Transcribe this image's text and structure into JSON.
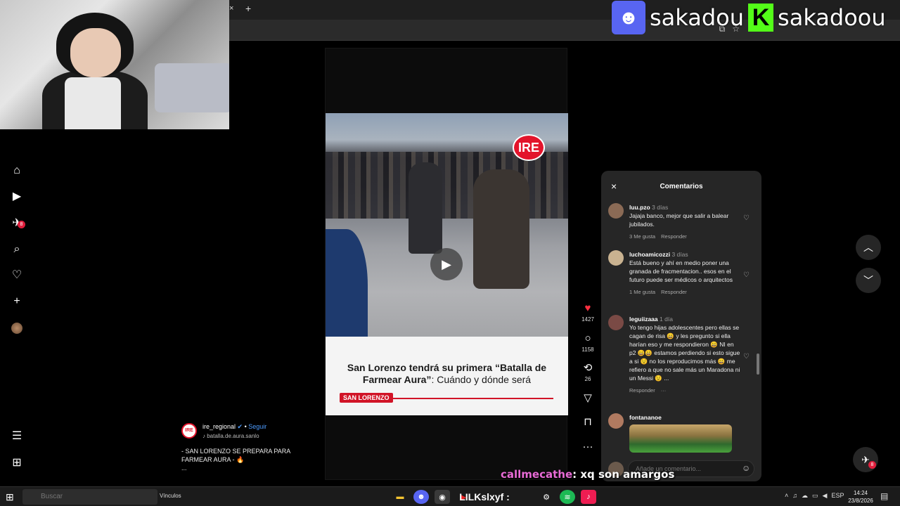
{
  "overlay": {
    "discord_name": "sakadou",
    "kick_name": "sakadoou",
    "discord_icon": "discord-icon",
    "kick_icon": "kick-icon",
    "discord_color": "#5865f2",
    "kick_color": "#53fc18"
  },
  "browser": {
    "tab_close": "×",
    "new_tab": "+"
  },
  "left_nav": {
    "items": [
      {
        "name": "home-icon",
        "glyph": "⌂"
      },
      {
        "name": "reels-icon",
        "glyph": "▶"
      },
      {
        "name": "messages-icon",
        "glyph": "✈",
        "badge": "8"
      },
      {
        "name": "search-icon",
        "glyph": "⌕"
      },
      {
        "name": "notifications-icon",
        "glyph": "♡"
      },
      {
        "name": "create-icon",
        "glyph": "+"
      },
      {
        "name": "profile-icon",
        "glyph": ""
      }
    ],
    "more_icon": "☰",
    "meta_icon": "⊞"
  },
  "reel": {
    "badge": "IRE",
    "play_icon": "▶",
    "headline_bold": "San Lorenzo tendrá su primera “Batalla de Farmear Aura”",
    "headline_rest": ": Cuándo y dónde será",
    "tag": "SAN LORENZO",
    "accent_color": "#d11427"
  },
  "actions": {
    "like_count": "1427",
    "comment_count": "1158",
    "repost_count": "26",
    "like_icon": "heart-icon",
    "comment_icon": "comment-icon",
    "repost_icon": "repost-icon",
    "share_icon": "share-icon",
    "save_icon": "bookmark-icon",
    "more_icon": "more-icon"
  },
  "author": {
    "avatar_text": "IRE",
    "username": "ire_regional",
    "verified": "✔",
    "follow": "Seguir",
    "audio": "batalla.de.aura.sanlo",
    "description_line1": "- SAN LORENZO SE PREPARA PARA FARMEAR AURA - 🔥",
    "description_more": "..."
  },
  "comments": {
    "title": "Comentarios",
    "close_icon": "×",
    "items": [
      {
        "user": "luu.pzo",
        "time": "3 días",
        "text": "Jajaja banco, mejor que salir a balear jubilados.",
        "likes": "3 Me gusta",
        "reply": "Responder"
      },
      {
        "user": "luchoamicozzi",
        "time": "3 días",
        "text": "Está bueno y ahí en medio poner una granada de fracmentacion.. esos en el futuro puede ser médicos o arquitectos",
        "likes": "1 Me gusta",
        "reply": "Responder"
      },
      {
        "user": "leguiizaaa",
        "time": "1 día",
        "text": "Yo tengo hijas adolescentes pero ellas se cagan de risa 😄 y les pregunto si ella harían eso y me respondieron 😄 NI en p2 😄😄 estamos perdiendo si esto sigue a si 😟 no los reproducimos más 😄 me refiero a que no sale más un Maradona ni un Messi 😟 ...",
        "likes": "",
        "reply": "Responder",
        "more": "···"
      },
      {
        "user": "fontananoe",
        "time": "",
        "text": "",
        "likes": "",
        "reply": ""
      }
    ],
    "input_placeholder": "Añade un comentario...",
    "emoji_icon": "☺"
  },
  "chat": {
    "user": "callmecathe",
    "text": ": xq son amargos",
    "overlay_text": "LILKslxyf :"
  },
  "nav_arrows": {
    "up": "︿",
    "down": "﹀"
  },
  "dm_badge": "8",
  "taskbar": {
    "search_placeholder": "Buscar",
    "links": "Vínculos",
    "language": "ESP",
    "time": "14:24",
    "date": "23/8/2026",
    "notif_count": "6"
  }
}
